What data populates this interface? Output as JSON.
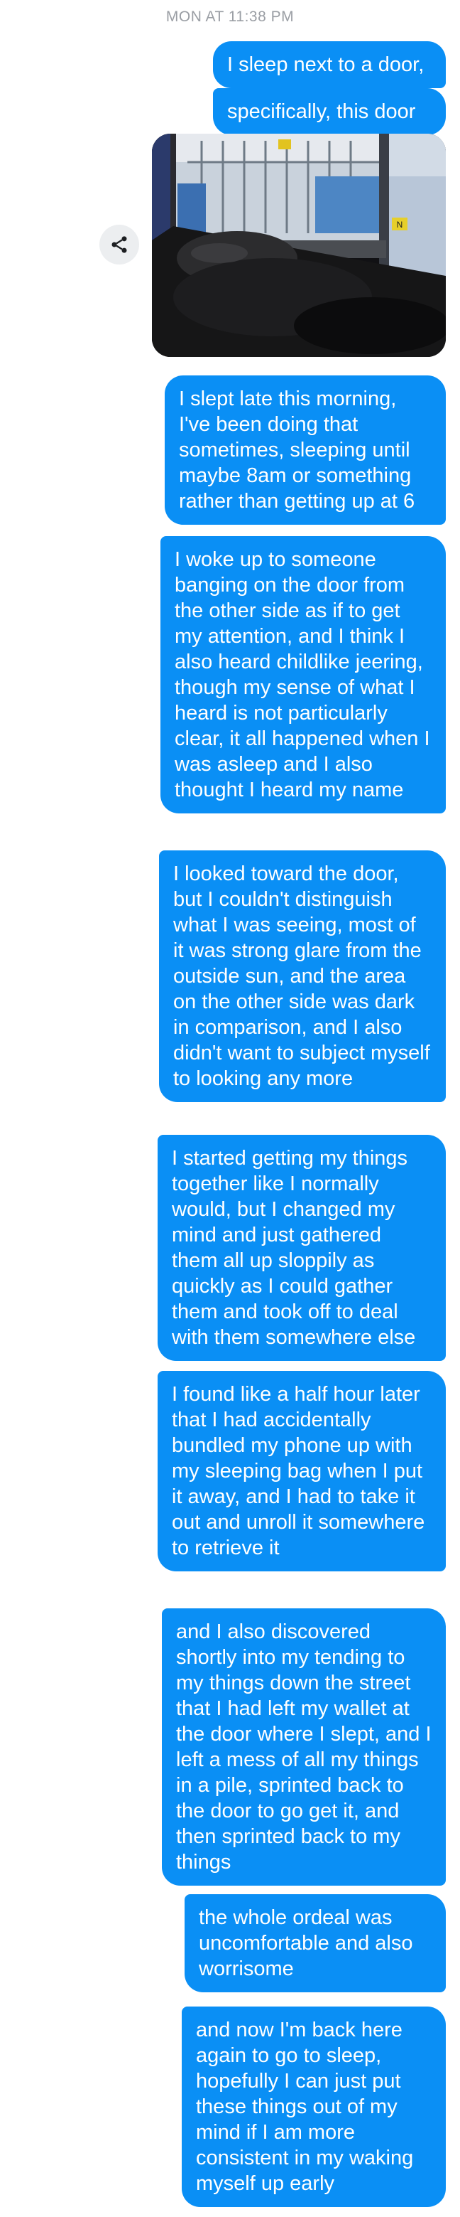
{
  "thread": {
    "timestamp": "MON AT 11:38 PM",
    "messages": [
      {
        "text": "I sleep next to a door,"
      },
      {
        "text": "specifically, this door"
      },
      {
        "text": "I slept late this morning, I've been doing that sometimes, sleeping until maybe 8am or something rather than getting up at 6"
      },
      {
        "text": "I woke up to someone banging on the door from the other side as if to get my attention, and I think I also heard childlike jeering, though my sense of what I heard is not particularly clear, it all happened when I was asleep and I also thought I heard my name"
      },
      {
        "text": "I looked toward the door, but I couldn't distinguish what I was seeing, most of it was strong glare from the outside sun, and the area on the other side was dark in comparison, and I also didn't want to subject myself to looking any more"
      },
      {
        "text": "I started getting my things together like I normally would, but I changed my mind and just gathered them all up sloppily as quickly as I could gather them and took off to deal with them somewhere else"
      },
      {
        "text": "I found like a half hour later that I had accidentally bundled my phone up with my sleeping bag when I put it away, and I had to take it out and unroll it somewhere to retrieve it"
      },
      {
        "text": "and I also discovered shortly into my tending to my things down the street that I had left my wallet at the door where I slept, and I left a mess of all my things in a pile, sprinted back to the door to go get it, and then sprinted back to my things"
      },
      {
        "text": "the whole ordeal was uncomfortable and also worrisome"
      },
      {
        "text": "and now I'm back here again to go to sleep, hopefully I can just put these things out of my mind if I am more consistent in my waking myself up early"
      }
    ]
  },
  "photo": {
    "sign_text": "N"
  },
  "icons": {
    "share": "share-icon"
  },
  "colors": {
    "bubble": "#0a8ff5",
    "bubble_text": "#ffffff",
    "timestamp": "#9a9ea4",
    "share_bg": "#eceef0"
  }
}
